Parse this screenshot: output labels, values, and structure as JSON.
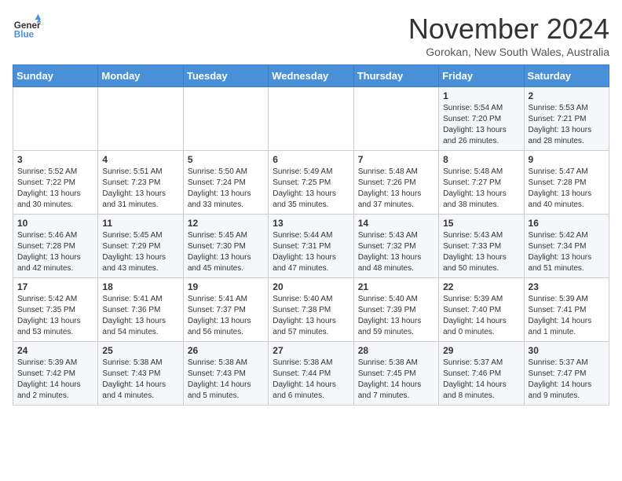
{
  "header": {
    "logo_line1": "General",
    "logo_line2": "Blue",
    "month": "November 2024",
    "location": "Gorokan, New South Wales, Australia"
  },
  "weekdays": [
    "Sunday",
    "Monday",
    "Tuesday",
    "Wednesday",
    "Thursday",
    "Friday",
    "Saturday"
  ],
  "weeks": [
    [
      {
        "day": "",
        "info": ""
      },
      {
        "day": "",
        "info": ""
      },
      {
        "day": "",
        "info": ""
      },
      {
        "day": "",
        "info": ""
      },
      {
        "day": "",
        "info": ""
      },
      {
        "day": "1",
        "info": "Sunrise: 5:54 AM\nSunset: 7:20 PM\nDaylight: 13 hours and 26 minutes."
      },
      {
        "day": "2",
        "info": "Sunrise: 5:53 AM\nSunset: 7:21 PM\nDaylight: 13 hours and 28 minutes."
      }
    ],
    [
      {
        "day": "3",
        "info": "Sunrise: 5:52 AM\nSunset: 7:22 PM\nDaylight: 13 hours and 30 minutes."
      },
      {
        "day": "4",
        "info": "Sunrise: 5:51 AM\nSunset: 7:23 PM\nDaylight: 13 hours and 31 minutes."
      },
      {
        "day": "5",
        "info": "Sunrise: 5:50 AM\nSunset: 7:24 PM\nDaylight: 13 hours and 33 minutes."
      },
      {
        "day": "6",
        "info": "Sunrise: 5:49 AM\nSunset: 7:25 PM\nDaylight: 13 hours and 35 minutes."
      },
      {
        "day": "7",
        "info": "Sunrise: 5:48 AM\nSunset: 7:26 PM\nDaylight: 13 hours and 37 minutes."
      },
      {
        "day": "8",
        "info": "Sunrise: 5:48 AM\nSunset: 7:27 PM\nDaylight: 13 hours and 38 minutes."
      },
      {
        "day": "9",
        "info": "Sunrise: 5:47 AM\nSunset: 7:28 PM\nDaylight: 13 hours and 40 minutes."
      }
    ],
    [
      {
        "day": "10",
        "info": "Sunrise: 5:46 AM\nSunset: 7:28 PM\nDaylight: 13 hours and 42 minutes."
      },
      {
        "day": "11",
        "info": "Sunrise: 5:45 AM\nSunset: 7:29 PM\nDaylight: 13 hours and 43 minutes."
      },
      {
        "day": "12",
        "info": "Sunrise: 5:45 AM\nSunset: 7:30 PM\nDaylight: 13 hours and 45 minutes."
      },
      {
        "day": "13",
        "info": "Sunrise: 5:44 AM\nSunset: 7:31 PM\nDaylight: 13 hours and 47 minutes."
      },
      {
        "day": "14",
        "info": "Sunrise: 5:43 AM\nSunset: 7:32 PM\nDaylight: 13 hours and 48 minutes."
      },
      {
        "day": "15",
        "info": "Sunrise: 5:43 AM\nSunset: 7:33 PM\nDaylight: 13 hours and 50 minutes."
      },
      {
        "day": "16",
        "info": "Sunrise: 5:42 AM\nSunset: 7:34 PM\nDaylight: 13 hours and 51 minutes."
      }
    ],
    [
      {
        "day": "17",
        "info": "Sunrise: 5:42 AM\nSunset: 7:35 PM\nDaylight: 13 hours and 53 minutes."
      },
      {
        "day": "18",
        "info": "Sunrise: 5:41 AM\nSunset: 7:36 PM\nDaylight: 13 hours and 54 minutes."
      },
      {
        "day": "19",
        "info": "Sunrise: 5:41 AM\nSunset: 7:37 PM\nDaylight: 13 hours and 56 minutes."
      },
      {
        "day": "20",
        "info": "Sunrise: 5:40 AM\nSunset: 7:38 PM\nDaylight: 13 hours and 57 minutes."
      },
      {
        "day": "21",
        "info": "Sunrise: 5:40 AM\nSunset: 7:39 PM\nDaylight: 13 hours and 59 minutes."
      },
      {
        "day": "22",
        "info": "Sunrise: 5:39 AM\nSunset: 7:40 PM\nDaylight: 14 hours and 0 minutes."
      },
      {
        "day": "23",
        "info": "Sunrise: 5:39 AM\nSunset: 7:41 PM\nDaylight: 14 hours and 1 minute."
      }
    ],
    [
      {
        "day": "24",
        "info": "Sunrise: 5:39 AM\nSunset: 7:42 PM\nDaylight: 14 hours and 2 minutes."
      },
      {
        "day": "25",
        "info": "Sunrise: 5:38 AM\nSunset: 7:43 PM\nDaylight: 14 hours and 4 minutes."
      },
      {
        "day": "26",
        "info": "Sunrise: 5:38 AM\nSunset: 7:43 PM\nDaylight: 14 hours and 5 minutes."
      },
      {
        "day": "27",
        "info": "Sunrise: 5:38 AM\nSunset: 7:44 PM\nDaylight: 14 hours and 6 minutes."
      },
      {
        "day": "28",
        "info": "Sunrise: 5:38 AM\nSunset: 7:45 PM\nDaylight: 14 hours and 7 minutes."
      },
      {
        "day": "29",
        "info": "Sunrise: 5:37 AM\nSunset: 7:46 PM\nDaylight: 14 hours and 8 minutes."
      },
      {
        "day": "30",
        "info": "Sunrise: 5:37 AM\nSunset: 7:47 PM\nDaylight: 14 hours and 9 minutes."
      }
    ]
  ]
}
